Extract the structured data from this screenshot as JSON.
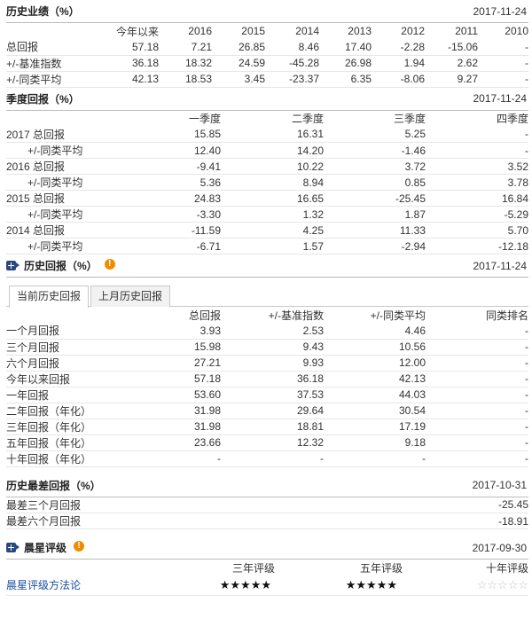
{
  "history": {
    "title": "历史业绩（%）",
    "date": "2017-11-24",
    "columns": [
      "今年以来",
      "2016",
      "2015",
      "2014",
      "2013",
      "2012",
      "2011",
      "2010"
    ],
    "rows": [
      {
        "label": "总回报",
        "values": [
          "57.18",
          "7.21",
          "26.85",
          "8.46",
          "17.40",
          "-2.28",
          "-15.06",
          "-"
        ]
      },
      {
        "label": "+/-基准指数",
        "values": [
          "36.18",
          "18.32",
          "24.59",
          "-45.28",
          "26.98",
          "1.94",
          "2.62",
          "-"
        ]
      },
      {
        "label": "+/-同类平均",
        "values": [
          "42.13",
          "18.53",
          "3.45",
          "-23.37",
          "6.35",
          "-8.06",
          "9.27",
          "-"
        ]
      }
    ]
  },
  "quarterly": {
    "title": "季度回报（%）",
    "date": "2017-11-24",
    "columns": [
      "一季度",
      "二季度",
      "三季度",
      "四季度"
    ],
    "rows": [
      {
        "label": "2017 总回报",
        "sub": false,
        "values": [
          "15.85",
          "16.31",
          "5.25",
          "-"
        ]
      },
      {
        "label": "+/-同类平均",
        "sub": true,
        "values": [
          "12.40",
          "14.20",
          "-1.46",
          "-"
        ]
      },
      {
        "label": "2016 总回报",
        "sub": false,
        "values": [
          "-9.41",
          "10.22",
          "3.72",
          "3.52"
        ]
      },
      {
        "label": "+/-同类平均",
        "sub": true,
        "values": [
          "5.36",
          "8.94",
          "0.85",
          "3.78"
        ]
      },
      {
        "label": "2015 总回报",
        "sub": false,
        "values": [
          "24.83",
          "16.65",
          "-25.45",
          "16.84"
        ]
      },
      {
        "label": "+/-同类平均",
        "sub": true,
        "values": [
          "-3.30",
          "1.32",
          "1.87",
          "-5.29"
        ]
      },
      {
        "label": "2014 总回报",
        "sub": false,
        "values": [
          "-11.59",
          "4.25",
          "11.33",
          "5.70"
        ]
      },
      {
        "label": "+/-同类平均",
        "sub": true,
        "values": [
          "-6.71",
          "1.57",
          "-2.94",
          "-12.18"
        ]
      }
    ]
  },
  "returns": {
    "title": "历史回报（%）",
    "date": "2017-11-24",
    "info_glyph": "!",
    "tabs": [
      "当前历史回报",
      "上月历史回报"
    ],
    "columns": [
      "总回报",
      "+/-基准指数",
      "+/-同类平均",
      "同类排名"
    ],
    "rows": [
      {
        "label": "一个月回报",
        "values": [
          "3.93",
          "2.53",
          "4.46",
          "-"
        ]
      },
      {
        "label": "三个月回报",
        "values": [
          "15.98",
          "9.43",
          "10.56",
          "-"
        ]
      },
      {
        "label": "六个月回报",
        "values": [
          "27.21",
          "9.93",
          "12.00",
          "-"
        ]
      },
      {
        "label": "今年以来回报",
        "values": [
          "57.18",
          "36.18",
          "42.13",
          "-"
        ]
      },
      {
        "label": "一年回报",
        "values": [
          "53.60",
          "37.53",
          "44.03",
          "-"
        ]
      },
      {
        "label": "二年回报（年化）",
        "values": [
          "31.98",
          "29.64",
          "30.54",
          "-"
        ]
      },
      {
        "label": "三年回报（年化）",
        "values": [
          "31.98",
          "18.81",
          "17.19",
          "-"
        ]
      },
      {
        "label": "五年回报（年化）",
        "values": [
          "23.66",
          "12.32",
          "9.18",
          "-"
        ]
      },
      {
        "label": "十年回报（年化）",
        "values": [
          "-",
          "-",
          "-",
          "-"
        ]
      }
    ]
  },
  "worst": {
    "title": "历史最差回报（%）",
    "date": "2017-10-31",
    "rows": [
      {
        "label": "最差三个月回报",
        "value": "-25.45"
      },
      {
        "label": "最差六个月回报",
        "value": "-18.91"
      }
    ]
  },
  "rating": {
    "title": "晨星评级",
    "date": "2017-09-30",
    "info_glyph": "!",
    "columns": [
      "三年评级",
      "五年评级",
      "十年评级"
    ],
    "method_link": "晨星评级方法论",
    "stars": [
      5,
      5,
      0
    ],
    "star_max": 5
  }
}
